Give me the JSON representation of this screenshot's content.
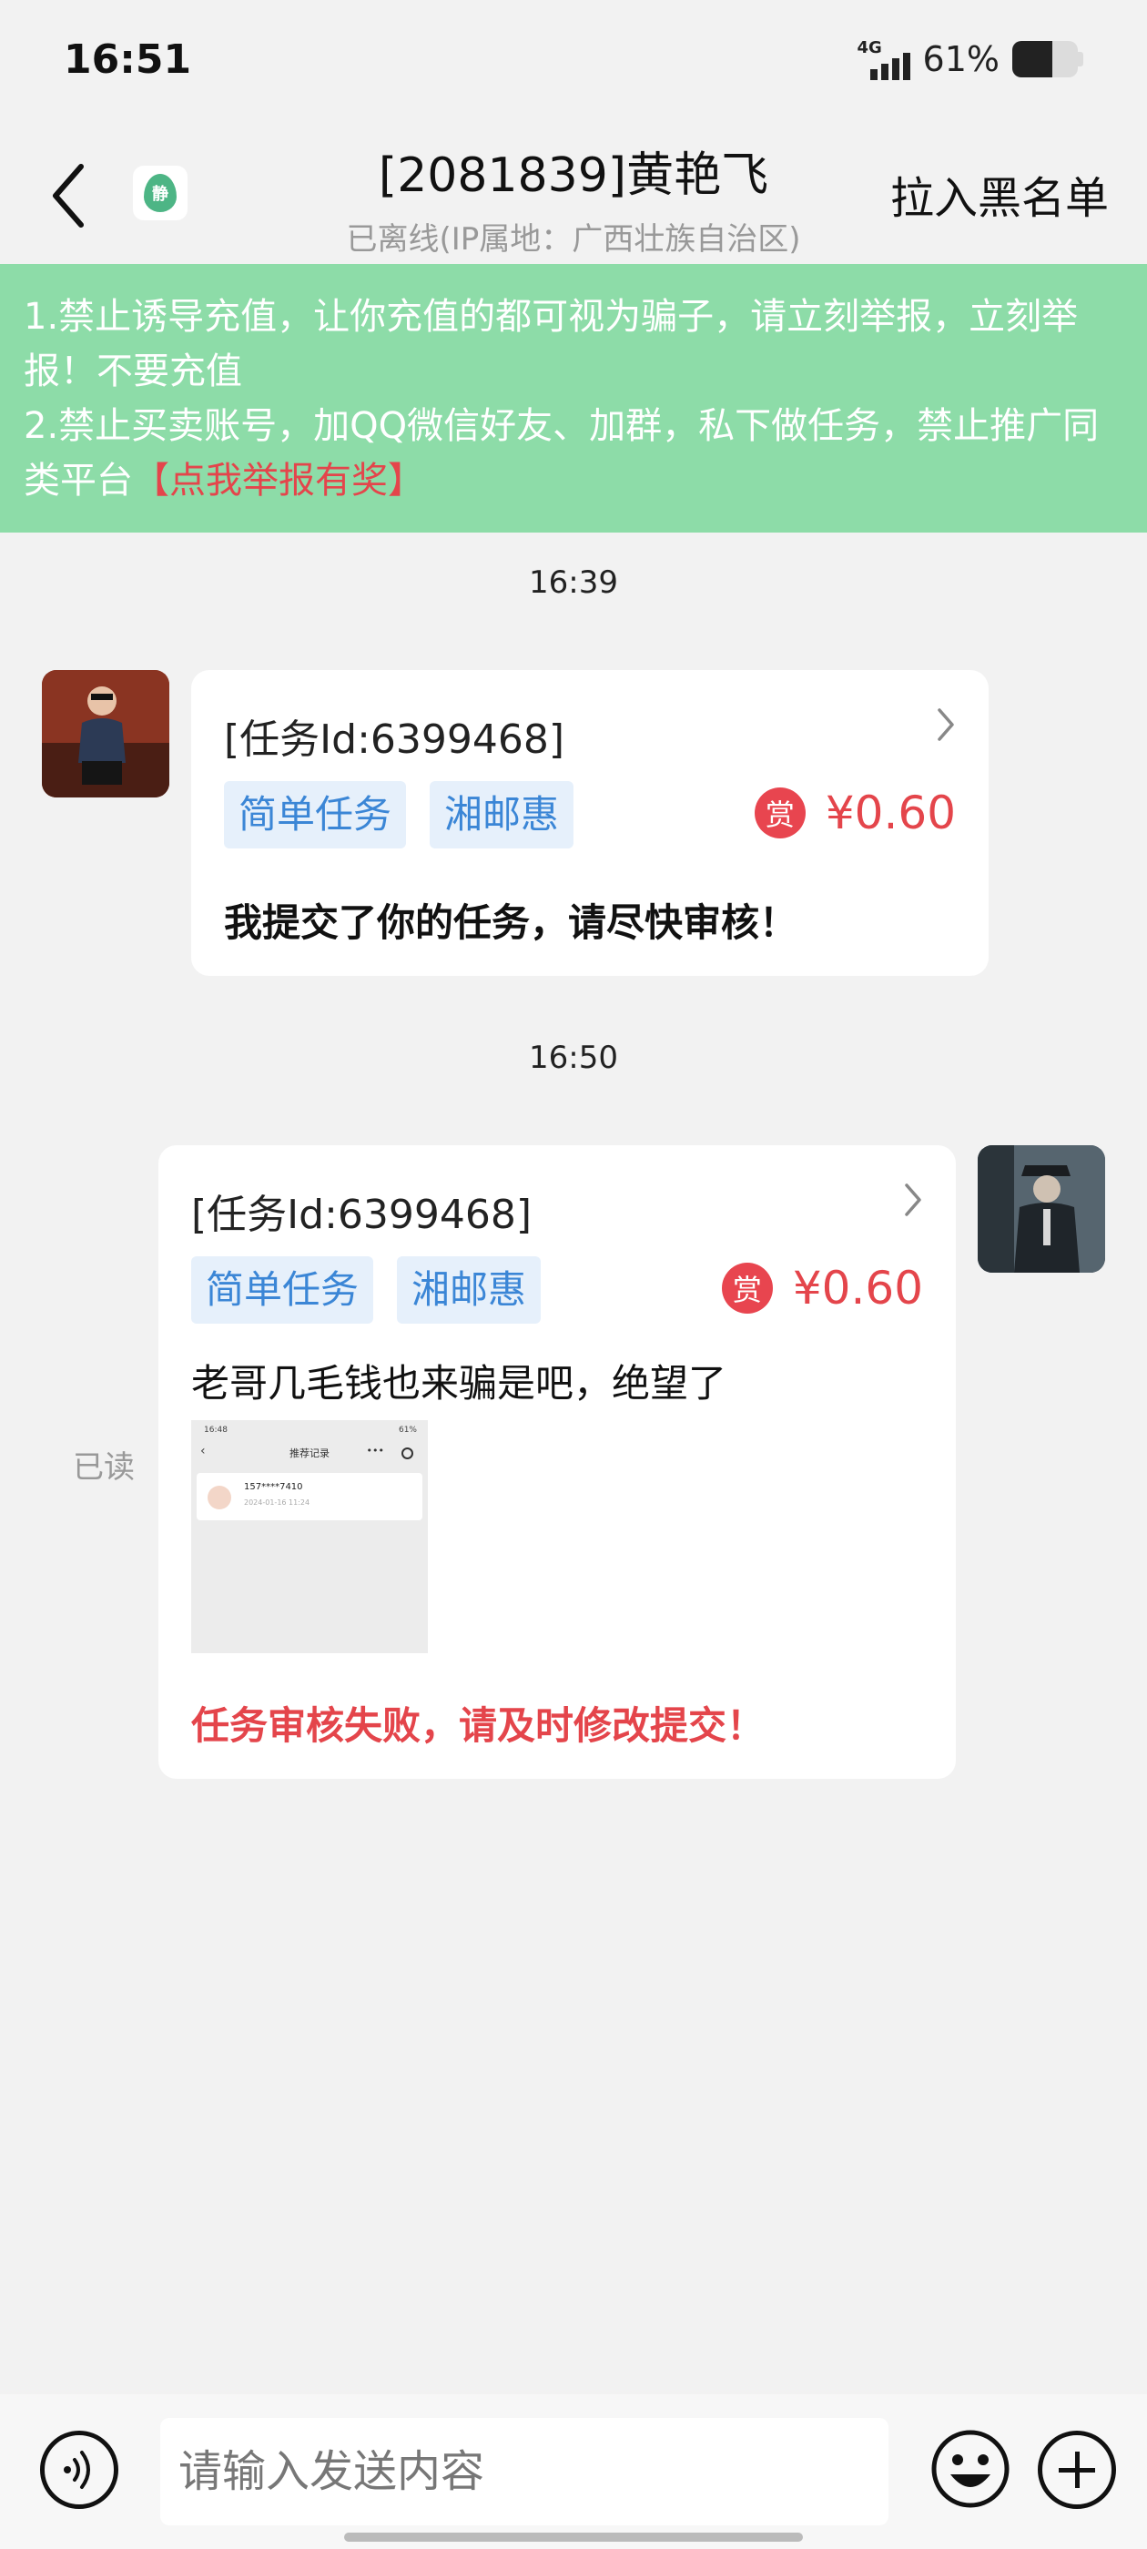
{
  "status_bar": {
    "time": "16:51",
    "network": "4G",
    "battery_pct": "61%",
    "battery_level": 0.61
  },
  "header": {
    "title": "[2081839]黄艳飞",
    "subtitle": "已离线(IP属地：广西壮族自治区)",
    "blacklist_label": "拉入黑名单",
    "logo_text": "静",
    "logo_color": "#4db585"
  },
  "notice": {
    "line1": "1.禁止诱导充值，让你充值的都可视为骗子，请立刻举报，立刻举报！不要充值",
    "line2": "2.禁止买卖账号，加QQ微信好友、加群，私下做任务，禁止推广同类平台",
    "report_link": "【点我举报有奖】",
    "background_color": "#8ddca8",
    "link_color": "#e4454b"
  },
  "messages": [
    {
      "timestamp": "16:39",
      "task_id": "[任务Id:6399468]",
      "tags": [
        "简单任务",
        "湘邮惠"
      ],
      "reward_badge": "赏",
      "reward_amount": "¥0.60",
      "text": "我提交了你的任务，请尽快审核！"
    },
    {
      "timestamp": "16:50",
      "task_id": "[任务Id:6399468]",
      "tags": [
        "简单任务",
        "湘邮惠"
      ],
      "reward_badge": "赏",
      "reward_amount": "¥0.60",
      "text": "老哥几毛钱也来骗是吧，绝望了",
      "status_text": "任务审核失败，请及时修改提交！",
      "read_label": "已读",
      "screenshot": {
        "time": "16:48",
        "status": "61%",
        "title": "推荐记录",
        "more": "•••",
        "entry_number": "157****7410",
        "entry_date": "2024-01-16 11:24"
      }
    }
  ],
  "input": {
    "placeholder": "请输入发送内容"
  },
  "colors": {
    "reward_red": "#e4454b",
    "tag_blue": "#3b86d6",
    "tag_bg": "#e6f0fb"
  },
  "icons": {
    "back": "chevron-left-icon",
    "voice": "voice-icon",
    "emoji": "smile-icon",
    "plus": "plus-icon",
    "chevron": "chevron-right-icon"
  }
}
